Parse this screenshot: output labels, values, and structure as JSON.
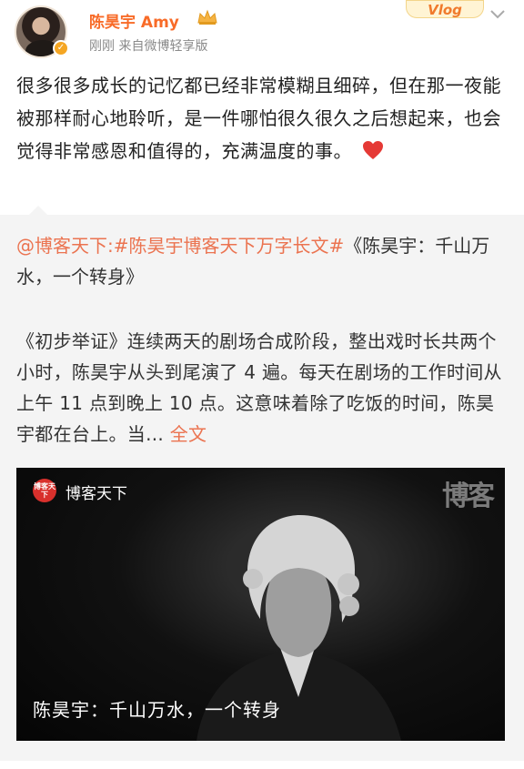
{
  "header": {
    "username": "陈昊宇 Amy",
    "meta": "刚刚  来自微博轻享版",
    "vlog_badge": "Vlog"
  },
  "post": {
    "text": "很多很多成长的记忆都已经非常模糊且细碎，但在那一夜能被那样耐心地聆听，是一件哪怕很久很久之后想起来，也会觉得非常感恩和值得的，充满温度的事。"
  },
  "repost": {
    "mention": "@博客天下:",
    "hashtag": "#陈昊宇博客天下万字长文#",
    "title_tail": "《陈昊宇：千山万水，一个转身》",
    "body": "《初步举证》连续两天的剧场合成阶段，整出戏时长共两个小时，陈昊宇从头到尾演了 4 遍。每天在剧场的工作时间从上午 11 点到晚上 10 点。这意味着除了吃饭的时间，陈昊宇都在台上。当...",
    "more_label": "全文"
  },
  "video": {
    "channel_logo_text": "博客天下",
    "channel_name": "博客天下",
    "watermark": "博客",
    "caption": "陈昊宇：千山万水，一个转身"
  },
  "colors": {
    "username": "#f86b28",
    "link": "#eb7350",
    "meta": "#8a8a8a",
    "repost_bg": "#f4f4f4"
  },
  "icons": [
    "avatar",
    "verified-badge",
    "crown-icon",
    "chevron-down-icon",
    "heart-icon",
    "channel-logo-icon"
  ]
}
